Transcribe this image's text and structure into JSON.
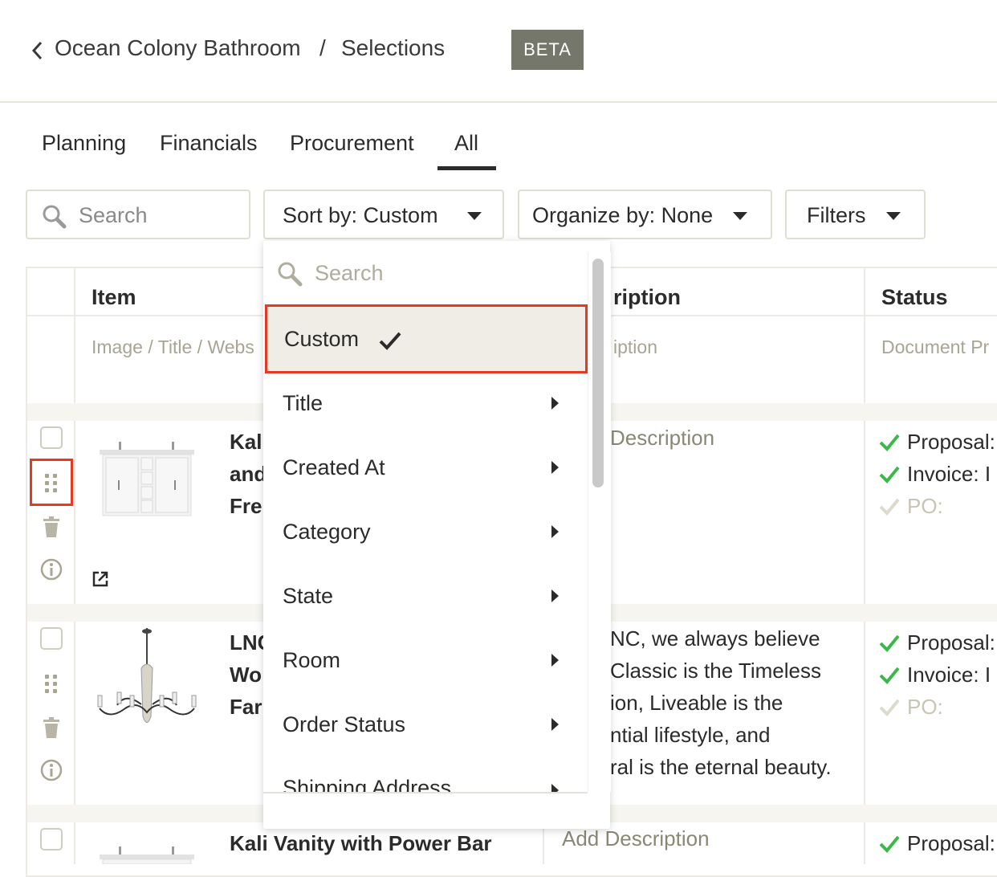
{
  "header": {
    "breadcrumb_project": "Ocean Colony Bathroom",
    "breadcrumb_sep": "/",
    "breadcrumb_page": "Selections",
    "badge": "BETA"
  },
  "tabs": [
    {
      "label": "Planning"
    },
    {
      "label": "Financials"
    },
    {
      "label": "Procurement"
    },
    {
      "label": "All",
      "active": true
    }
  ],
  "toolbar": {
    "search_placeholder": "Search",
    "sort_label": "Sort by: Custom",
    "organize_label": "Organize by: None",
    "filters_label": "Filters"
  },
  "table": {
    "columns": [
      {
        "header": "Item",
        "sub": "Image / Title / Webs"
      },
      {
        "header": "ription",
        "sub": "iption"
      },
      {
        "header": "Status",
        "sub": "Document Pr"
      }
    ],
    "rows": [
      {
        "title_lines": [
          "Kali",
          "and",
          "Fre"
        ],
        "description": "Description",
        "status": [
          {
            "label": "Proposal:",
            "done": true
          },
          {
            "label": "Invoice: I",
            "done": true
          },
          {
            "label": "PO:",
            "done": false
          }
        ]
      },
      {
        "title_lines": [
          "LNC",
          "Wo",
          "Far"
        ],
        "description_lines": [
          "NC, we always believe",
          "Classic is the Timeless",
          "ion, Liveable is the",
          "ntial lifestyle, and",
          "ral is the eternal beauty."
        ],
        "status": [
          {
            "label": "Proposal:",
            "done": true
          },
          {
            "label": "Invoice: I",
            "done": true
          },
          {
            "label": "PO:",
            "done": false
          }
        ]
      },
      {
        "title": "Kali Vanity with Power Bar",
        "description": "Add Description",
        "status": [
          {
            "label": "Proposal:",
            "done": true
          }
        ]
      }
    ]
  },
  "sort_dropdown": {
    "search_placeholder": "Search",
    "items": [
      {
        "label": "Custom",
        "selected": true
      },
      {
        "label": "Title"
      },
      {
        "label": "Created At"
      },
      {
        "label": "Category"
      },
      {
        "label": "State"
      },
      {
        "label": "Room"
      },
      {
        "label": "Order Status"
      },
      {
        "label": "Shipping Address"
      }
    ]
  },
  "colors": {
    "accent_dark": "#2b2b2b",
    "badge_bg": "#76776b",
    "highlight_red": "#e53a1f",
    "check_green": "#3cb84a",
    "muted_text": "#a8a594"
  }
}
